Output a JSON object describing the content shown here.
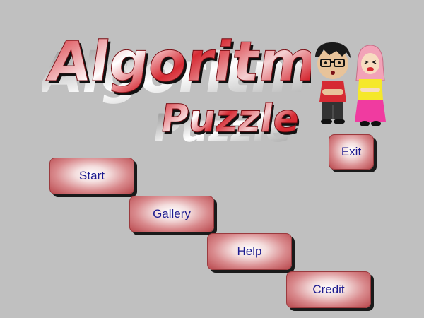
{
  "title": {
    "word1": "Algoritma",
    "word2": "Puzzle"
  },
  "menu": {
    "start_label": "Start",
    "gallery_label": "Gallery",
    "help_label": "Help",
    "credit_label": "Credit",
    "exit_label": "Exit"
  },
  "colors": {
    "background": "#c0c0c0",
    "logo_red": "#d62a33",
    "button_text": "#1c1a8f",
    "button_red": "#b8474c"
  },
  "characters": [
    "boy-character",
    "girl-character"
  ]
}
